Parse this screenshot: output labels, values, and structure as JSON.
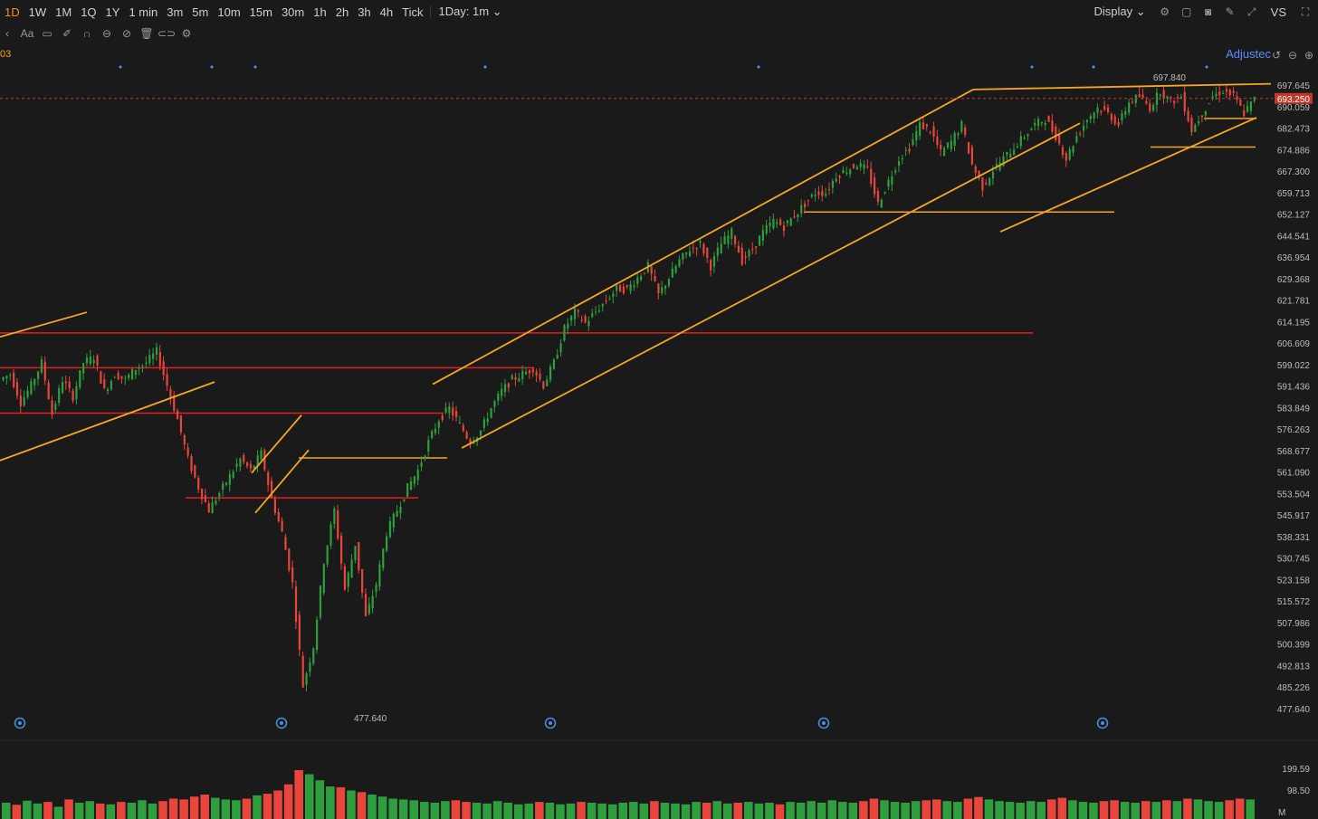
{
  "toolbar": {
    "timeframes": [
      "1D",
      "1W",
      "1M",
      "1Q",
      "1Y",
      "1 min",
      "3m",
      "5m",
      "10m",
      "15m",
      "30m",
      "1h",
      "2h",
      "3h",
      "4h",
      "Tick"
    ],
    "active_timeframe": "1D",
    "range_selector": "1Day: 1m",
    "display_label": "Display",
    "vs_label": "VS",
    "adjusted_label": "Adjustec",
    "symbol_fragment": "03"
  },
  "colors": {
    "background": "#1a1a1a",
    "up": "#2e9e3e",
    "down": "#e8453c",
    "trendline_orange": "#f5a623",
    "level_red": "#e02020",
    "last_price_bg": "#c0392b",
    "event_marker": "#4a90e2"
  },
  "icons": [
    "aa-text-icon",
    "comment-icon",
    "magnet-icon",
    "layers-icon",
    "hide-icon",
    "trash-icon",
    "link-icon",
    "settings-icon",
    "camera-icon",
    "pencil-icon",
    "fullscreen-icon",
    "expand-icon"
  ],
  "chart_data": {
    "type": "candlestick",
    "price_axis_ticks": [
      "697.645",
      "690.059",
      "682.473",
      "674.886",
      "667.300",
      "659.713",
      "652.127",
      "644.541",
      "636.954",
      "629.368",
      "621.781",
      "614.195",
      "606.609",
      "599.022",
      "591.436",
      "583.849",
      "576.263",
      "568.677",
      "561.090",
      "553.504",
      "545.917",
      "538.331",
      "530.745",
      "523.158",
      "515.572",
      "507.986",
      "500.399",
      "492.813",
      "485.226",
      "477.640"
    ],
    "ylim": [
      477.64,
      697.645
    ],
    "last_price": "693.250",
    "high_annotation": "697.840",
    "low_annotation": "477.640",
    "volume_axis_ticks": [
      "199.59",
      "98.50"
    ],
    "volume_unit": "M",
    "close_path": [
      596,
      586,
      592,
      600,
      582,
      594,
      588,
      600,
      602,
      590,
      596,
      594,
      598,
      600,
      604,
      592,
      580,
      566,
      556,
      548,
      554,
      560,
      566,
      562,
      568,
      552,
      540,
      522,
      486,
      500,
      530,
      548,
      520,
      536,
      510,
      522,
      540,
      548,
      556,
      562,
      572,
      580,
      584,
      578,
      572,
      576,
      584,
      590,
      594,
      596,
      598,
      592,
      600,
      612,
      618,
      614,
      618,
      622,
      626,
      626,
      630,
      634,
      624,
      630,
      636,
      640,
      642,
      634,
      642,
      646,
      636,
      640,
      646,
      650,
      648,
      652,
      656,
      660,
      660,
      666,
      668,
      670,
      668,
      656,
      664,
      672,
      676,
      684,
      682,
      674,
      678,
      684,
      670,
      662,
      668,
      672,
      676,
      680,
      684,
      686,
      680,
      672,
      680,
      686,
      690,
      688,
      684,
      692,
      694,
      690,
      696,
      692,
      694,
      682,
      688,
      694,
      696,
      694,
      688,
      693
    ],
    "volume_path": [
      40,
      35,
      45,
      38,
      42,
      30,
      48,
      40,
      44,
      38,
      36,
      42,
      40,
      46,
      38,
      44,
      50,
      48,
      55,
      60,
      52,
      48,
      46,
      50,
      58,
      62,
      70,
      85,
      120,
      110,
      95,
      80,
      78,
      70,
      66,
      60,
      55,
      50,
      48,
      46,
      42,
      40,
      44,
      46,
      42,
      40,
      38,
      44,
      40,
      36,
      38,
      42,
      40,
      36,
      38,
      42,
      40,
      38,
      36,
      40,
      42,
      38,
      44,
      40,
      38,
      36,
      42,
      40,
      44,
      38,
      40,
      42,
      38,
      40,
      36,
      42,
      40,
      44,
      40,
      46,
      42,
      40,
      44,
      50,
      46,
      42,
      40,
      44,
      46,
      48,
      44,
      42,
      50,
      54,
      48,
      44,
      42,
      40,
      44,
      42,
      48,
      52,
      46,
      42,
      40,
      44,
      46,
      42,
      40,
      44,
      42,
      46,
      44,
      50,
      48,
      44,
      42,
      46,
      50,
      48
    ],
    "xlim": [
      0,
      1400
    ],
    "horizontal_levels": [
      {
        "price": 610.5,
        "x0": 0,
        "x1": 1141,
        "color": "red"
      },
      {
        "price": 598.2,
        "x0": 0,
        "x1": 590,
        "color": "red"
      },
      {
        "price": 582.2,
        "x0": 0,
        "x1": 490,
        "color": "red"
      },
      {
        "price": 552.3,
        "x0": 205,
        "x1": 462,
        "color": "red"
      },
      {
        "price": 566.4,
        "x0": 330,
        "x1": 494,
        "color": "orange"
      },
      {
        "price": 653.2,
        "x0": 888,
        "x1": 1231,
        "color": "orange"
      },
      {
        "price": 676.1,
        "x0": 1271,
        "x1": 1387,
        "color": "orange"
      },
      {
        "price": 686.2,
        "x0": 1330,
        "x1": 1388,
        "color": "orange"
      }
    ],
    "trendlines": [
      {
        "p0": [
          0,
          609.1
        ],
        "p1": [
          96,
          617.8
        ],
        "color": "orange"
      },
      {
        "p0": [
          0,
          565.5
        ],
        "p1": [
          237,
          593.2
        ],
        "color": "orange"
      },
      {
        "p0": [
          278,
          561.1
        ],
        "p1": [
          333,
          581.5
        ],
        "color": "orange"
      },
      {
        "p0": [
          282,
          547.0
        ],
        "p1": [
          341,
          569.2
        ],
        "color": "orange"
      },
      {
        "p0": [
          478,
          592.4
        ],
        "p1": [
          1075,
          696.4
        ],
        "color": "orange"
      },
      {
        "p0": [
          510,
          569.9
        ],
        "p1": [
          1193,
          684.5
        ],
        "color": "orange"
      },
      {
        "p0": [
          1075,
          696.4
        ],
        "p1": [
          1404,
          698.4
        ],
        "color": "orange"
      },
      {
        "p0": [
          1105,
          646.2
        ],
        "p1": [
          1388,
          686.5
        ],
        "color": "orange"
      }
    ],
    "event_markers_top_x": [
      133,
      234,
      282,
      536,
      838,
      1140,
      1208,
      1333
    ],
    "event_markers_bottom_x": [
      22,
      311,
      608,
      910,
      1218
    ]
  }
}
